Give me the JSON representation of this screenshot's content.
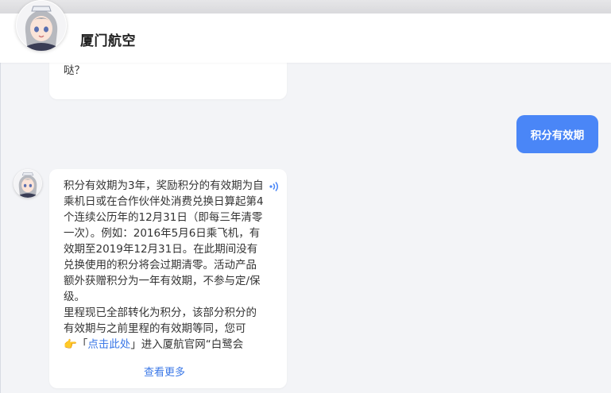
{
  "header": {
    "title": "厦门航空",
    "avatar": "assistant-avatar"
  },
  "messages": {
    "first_partial": "本次会话保存记录。请问有什么可以帮您哒？",
    "user": "积分有效期",
    "bot_paragraph1": "积分有效期为3年，奖励积分的有效期为自乘机日或在合作伙伴处消费兑换日算起第4个连续公历年的12月31日（即每三年清零一次）。例如：2016年5月6日乘飞机，有效期至2019年12月31日。在此期间没有兑换使用的积分将会过期清零。活动产品额外获赠积分为一年有效期，不参与定/保级。",
    "bot_paragraph2": "里程现已全部转化为积分，该部分积分的有效期与之前里程的有效期等同，您可",
    "pointer_emoji": "👉",
    "quote_open": "「",
    "link_text": "点击此处",
    "quote_close_tail": "」进入厦航官网“白鹭会",
    "see_more": "查看更多"
  },
  "icons": {
    "speaker": "speaker-icon",
    "bot_avatar": "bot-avatar"
  },
  "colors": {
    "accent": "#4a86f7",
    "link": "#3b78e7",
    "background": "#f3f4f7"
  }
}
